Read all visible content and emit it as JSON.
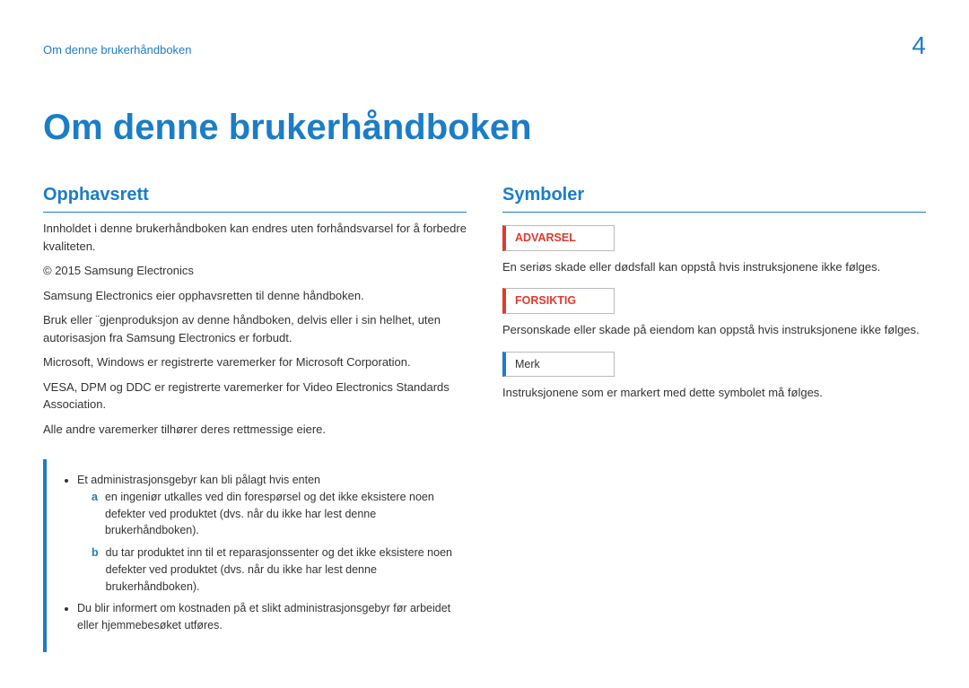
{
  "header": {
    "breadcrumb": "Om denne brukerhåndboken",
    "page_number": "4"
  },
  "chapter_title": "Om denne brukerhåndboken",
  "left": {
    "heading": "Opphavsrett",
    "paragraphs": [
      "Innholdet i denne brukerhåndboken kan endres uten forhåndsvarsel for å forbedre kvaliteten.",
      "© 2015 Samsung Electronics",
      "Samsung Electronics eier opphavsretten til denne håndboken.",
      "Bruk eller ¨gjenproduksjon av denne håndboken, delvis eller i sin helhet, uten autorisasjon fra Samsung Electronics er forbudt.",
      "Microsoft, Windows er registrerte varemerker for Microsoft Corporation.",
      "VESA, DPM og DDC er registrerte varemerker for Video Electronics Standards Association.",
      "Alle andre varemerker tilhører deres rettmessige eiere."
    ],
    "notice": {
      "bullet1": "Et administrasjonsgebyr kan bli pålagt hvis enten",
      "sub": [
        {
          "key": "a",
          "text": "en ingeniør utkalles ved din forespørsel og det ikke eksistere noen defekter ved produktet (dvs. når du ikke har lest denne brukerhåndboken)."
        },
        {
          "key": "b",
          "text": "du tar produktet inn til et reparasjonssenter og det ikke eksistere noen defekter ved produktet (dvs. når du ikke har lest denne brukerhåndboken)."
        }
      ],
      "bullet2": "Du blir informert om kostnaden på et slikt administrasjonsgebyr før arbeidet eller hjemmebesøket utføres."
    }
  },
  "right": {
    "heading": "Symboler",
    "items": [
      {
        "label": "ADVARSEL",
        "style": "red",
        "desc": "En seriøs skade eller dødsfall kan oppstå hvis instruksjonene ikke følges."
      },
      {
        "label": "FORSIKTIG",
        "style": "red",
        "desc": "Personskade eller skade på eiendom kan oppstå hvis instruksjonene ikke følges."
      },
      {
        "label": "Merk",
        "style": "blue",
        "desc": "Instruksjonene som er markert med dette symbolet må følges."
      }
    ]
  }
}
